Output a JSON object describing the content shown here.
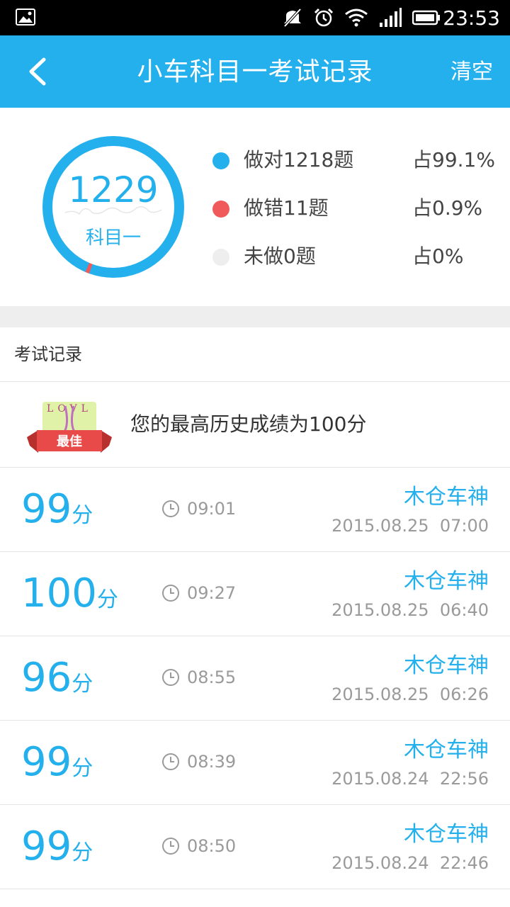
{
  "status_bar": {
    "time": "23:53",
    "icons": [
      "image-notification-icon",
      "mute-icon",
      "alarm-icon",
      "wifi-icon",
      "signal-icon",
      "battery-icon"
    ]
  },
  "header": {
    "title": "小车科目一考试记录",
    "clear_label": "清空",
    "back_icon": "chevron-left-icon"
  },
  "summary": {
    "total": "1229",
    "subject": "科目一",
    "correct_fraction": 0.991,
    "wrong_fraction": 0.009,
    "legend": [
      {
        "label": "做对1218题",
        "percent": "占99.1%",
        "color": "#23b0ec"
      },
      {
        "label": "做错11题",
        "percent": "占0.9%",
        "color": "#f05a5a"
      },
      {
        "label": "未做0题",
        "percent": "占0%",
        "color": "#eeeeee"
      }
    ]
  },
  "records_section": {
    "title": "考试记录",
    "best_badge": "最佳",
    "best_text": "您的最高历史成绩为100分"
  },
  "records": [
    {
      "score": "99",
      "unit": "分",
      "duration": "09:01",
      "nickname": "木仓车神",
      "datetime": "2015.08.25  07:00"
    },
    {
      "score": "100",
      "unit": "分",
      "duration": "09:27",
      "nickname": "木仓车神",
      "datetime": "2015.08.25  06:40"
    },
    {
      "score": "96",
      "unit": "分",
      "duration": "08:55",
      "nickname": "木仓车神",
      "datetime": "2015.08.25  06:26"
    },
    {
      "score": "99",
      "unit": "分",
      "duration": "08:39",
      "nickname": "木仓车神",
      "datetime": "2015.08.24  22:56"
    },
    {
      "score": "99",
      "unit": "分",
      "duration": "08:50",
      "nickname": "木仓车神",
      "datetime": "2015.08.24  22:46"
    }
  ],
  "colors": {
    "accent": "#23b0ec",
    "wrong": "#f05a5a",
    "unanswered": "#eeeeee",
    "badge_red": "#e84a4a"
  }
}
